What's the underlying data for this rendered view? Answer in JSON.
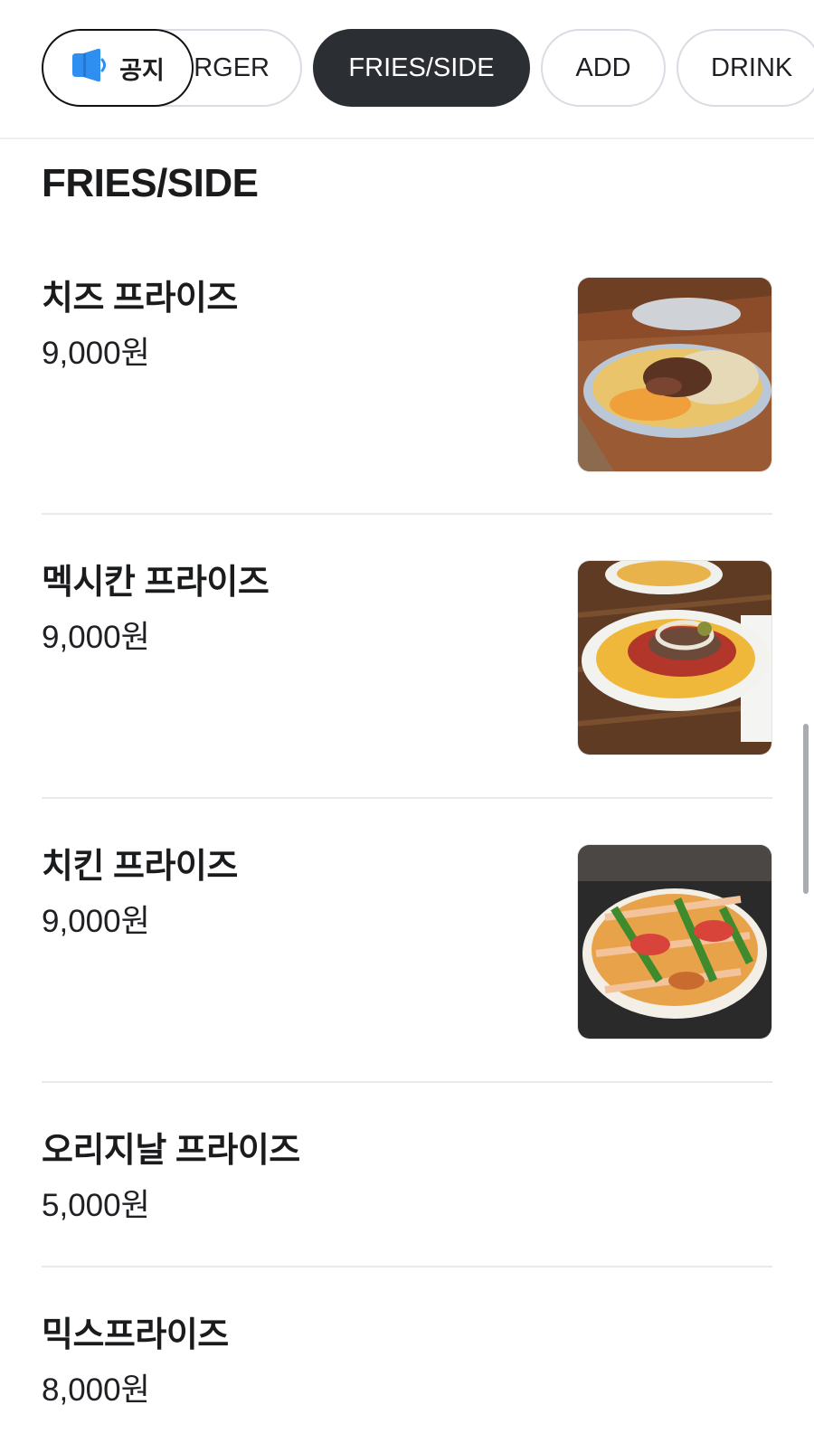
{
  "categories": [
    {
      "label": "RGER",
      "state": "partial"
    },
    {
      "label": "FRIES/SIDE",
      "state": "active"
    },
    {
      "label": "ADD",
      "state": "normal"
    },
    {
      "label": "DRINK",
      "state": "normal"
    }
  ],
  "notice": {
    "label": "공지",
    "icon": "megaphone-icon"
  },
  "section": {
    "title": "FRIES/SIDE"
  },
  "items": [
    {
      "name": "치즈 프라이즈",
      "price": "9,000원"
    },
    {
      "name": "멕시칸 프라이즈",
      "price": "9,000원"
    },
    {
      "name": "치킨 프라이즈",
      "price": "9,000원"
    },
    {
      "name": "오리지날 프라이즈",
      "price": "5,000원"
    },
    {
      "name": "믹스프라이즈",
      "price": "8,000원"
    }
  ],
  "colors": {
    "active_chip": "#2b2e33",
    "accent_icon": "#2f8ff0",
    "divider": "#e8eaee"
  }
}
